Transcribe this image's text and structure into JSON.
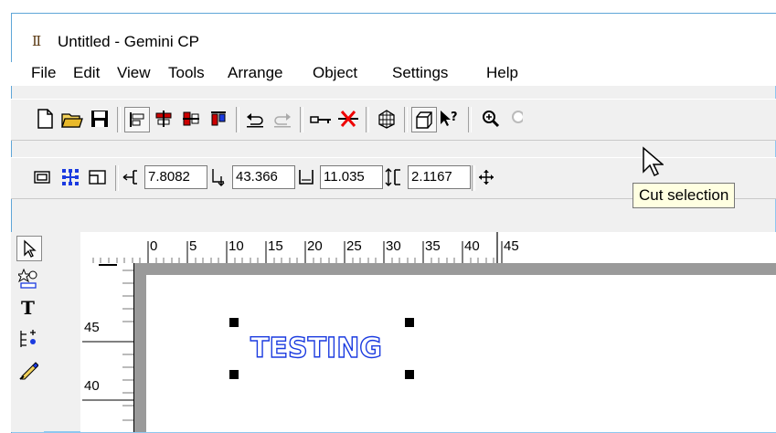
{
  "window": {
    "title": "Untitled - Gemini CP",
    "app_icon_glyph": "Ⅱ"
  },
  "menu": [
    {
      "label": "File"
    },
    {
      "label": "Edit"
    },
    {
      "label": "View"
    },
    {
      "label": "Tools"
    },
    {
      "label": "Arrange"
    },
    {
      "label": "Object"
    },
    {
      "label": "Settings"
    },
    {
      "label": "Help"
    }
  ],
  "toolbar2": {
    "x_value": "7.8082",
    "y_value": "43.366",
    "width_value": "11.035",
    "height_value": "2.1167"
  },
  "tooltip": {
    "text": "Cut selection"
  },
  "ruler": {
    "h_labels": [
      "0",
      "5",
      "10",
      "15",
      "20",
      "25",
      "30",
      "35",
      "40",
      "45"
    ],
    "v_labels": [
      "45",
      "40"
    ]
  },
  "canvas": {
    "object_text": "TESTING"
  },
  "colors": {
    "accent_blue": "#1b3be0",
    "tooltip_bg": "#ffffe1",
    "canvas_gray": "#9a9a9a"
  }
}
